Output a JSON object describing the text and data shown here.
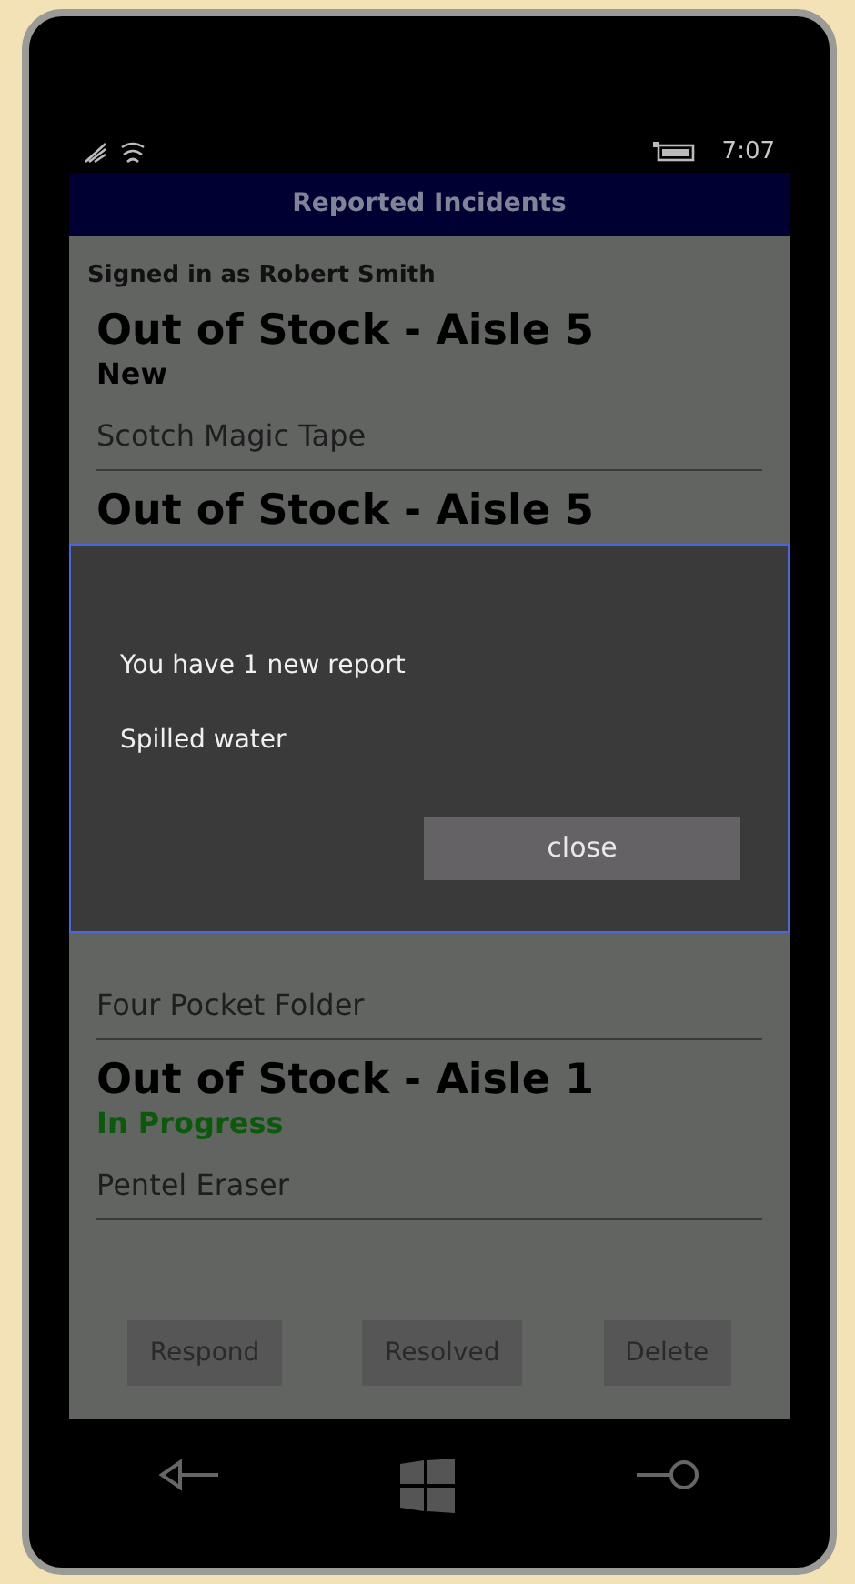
{
  "status_bar": {
    "time": "7:07"
  },
  "header": {
    "title": "Reported Incidents"
  },
  "signed_in": "Signed in as Robert Smith",
  "incidents_above": [
    {
      "title": "Out of Stock - Aisle 5",
      "status": "New",
      "color": "#000000",
      "item": "Scotch Magic Tape"
    },
    {
      "title": "Out of Stock - Aisle 5"
    }
  ],
  "dialog": {
    "message": "You have 1 new report",
    "detail": "Spilled water",
    "button": "close"
  },
  "incidents_below": [
    {
      "item": "Four Pocket Folder"
    },
    {
      "title": "Out of Stock - Aisle 1",
      "status": "In Progress",
      "color": "#0b5a0b",
      "item": "Pentel Eraser"
    }
  ],
  "actions": [
    "Respond",
    "Resolved",
    "Delete"
  ]
}
